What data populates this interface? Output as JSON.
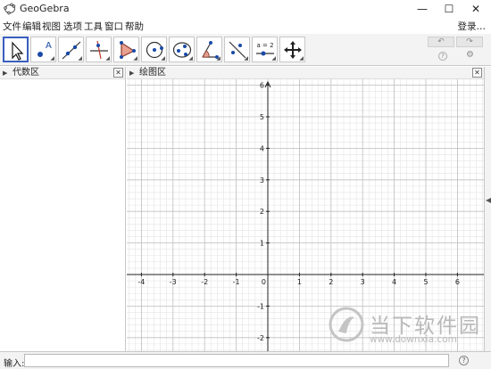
{
  "window": {
    "title": "GeoGebra",
    "minimize_glyph": "—",
    "maximize_glyph": "☐",
    "close_glyph": "✕"
  },
  "menu": {
    "items": [
      "文件",
      "编辑",
      "视图",
      "选项",
      "工具",
      "窗口",
      "帮助"
    ],
    "login": "登录…"
  },
  "toolbar": {
    "tools": [
      {
        "icon": "move-arrow-icon",
        "active": true
      },
      {
        "icon": "point-icon",
        "label": "A"
      },
      {
        "icon": "line-icon"
      },
      {
        "icon": "perpendicular-line-icon"
      },
      {
        "icon": "polygon-icon"
      },
      {
        "icon": "circle-icon"
      },
      {
        "icon": "ellipse-icon"
      },
      {
        "icon": "angle-icon"
      },
      {
        "icon": "reflect-icon"
      },
      {
        "icon": "slider-icon",
        "label": "a = 2"
      },
      {
        "icon": "move-view-icon"
      }
    ],
    "undo_glyph": "↶",
    "redo_glyph": "↷",
    "help_glyph": "?",
    "settings_glyph": "⚙"
  },
  "algebra_view": {
    "title": "代数区",
    "close_glyph": "✕"
  },
  "graphics_view": {
    "title": "绘图区",
    "close_glyph": "✕",
    "x_ticks": [
      "-4",
      "-3",
      "-2",
      "-1",
      "0",
      "1",
      "2",
      "3",
      "4",
      "5",
      "6"
    ],
    "y_ticks": [
      "6",
      "5",
      "4",
      "3",
      "2",
      "1",
      "0",
      "-1",
      "-2"
    ]
  },
  "input_bar": {
    "label": "输入:",
    "value": "",
    "help_glyph": "?"
  },
  "watermark": {
    "name": "当下软件园",
    "url": "www.downxia.com"
  },
  "colors": {
    "accent": "#3a5fbf",
    "grid_major": "#c0c0c0",
    "grid_minor": "#e4e4e4",
    "axis": "#222222"
  }
}
